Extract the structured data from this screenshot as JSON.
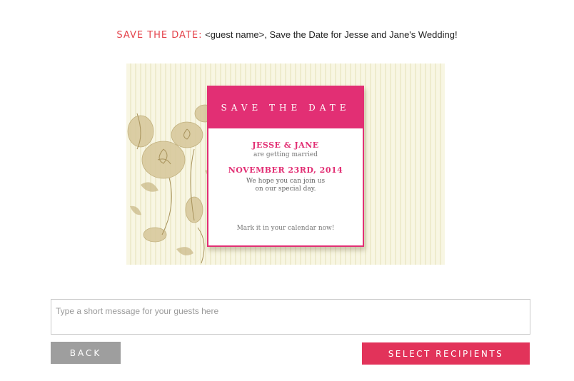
{
  "subject": {
    "label": "SAVE THE DATE:",
    "text": "<guest name>, Save the Date for Jesse and Jane's Wedding!"
  },
  "card": {
    "header": "SAVE THE DATE",
    "names": "JESSE & JANE",
    "subtitle": "are getting married",
    "date": "NOVEMBER 23RD, 2014",
    "message_line1": "We hope you can join us",
    "message_line2": "on our special day.",
    "footer": "Mark it in your calendar now!",
    "colors": {
      "accent": "#e22f74",
      "background": "#f8f6e3"
    },
    "decoration": "floral-illustration"
  },
  "message_input": {
    "placeholder": "Type a short message for your guests here",
    "value": ""
  },
  "actions": {
    "back_label": "BACK",
    "select_recipients_label": "SELECT RECIPIENTS"
  },
  "colors": {
    "subject_label": "#e4434b",
    "back_button": "#9e9e9e",
    "primary_button": "#e2335a"
  }
}
